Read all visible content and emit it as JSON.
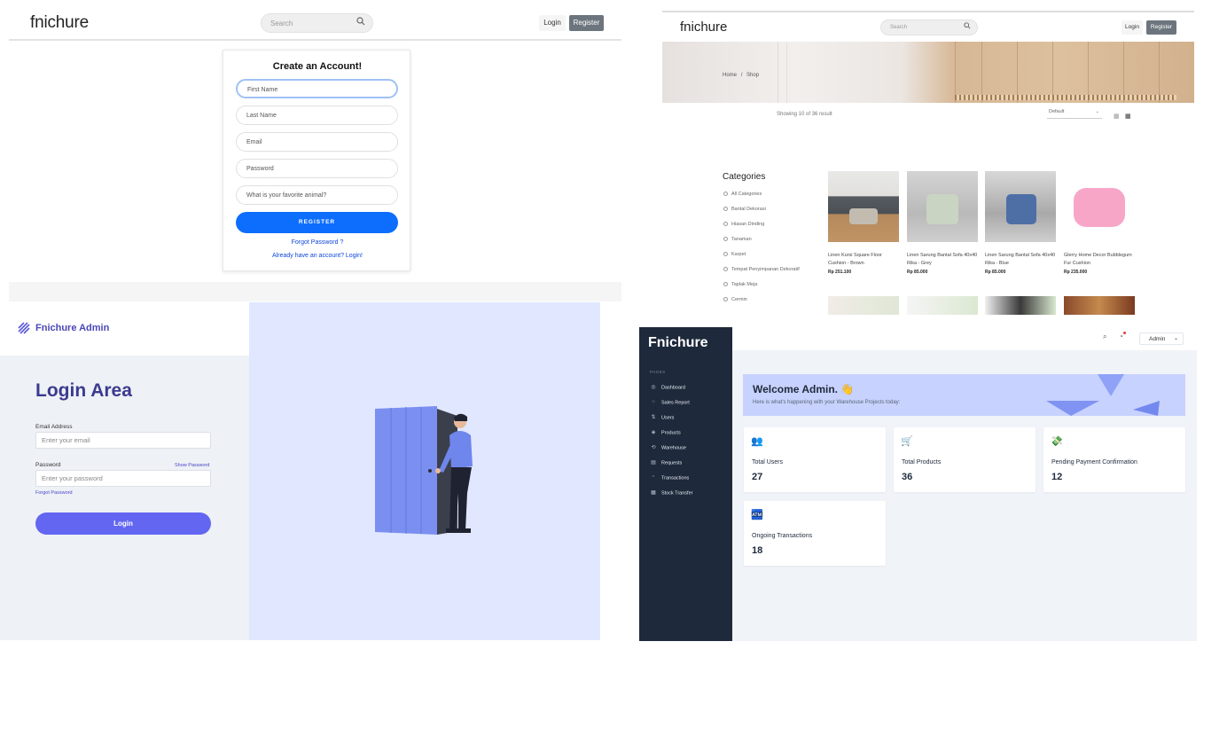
{
  "register_page": {
    "brand": "fnichure",
    "search_placeholder": "Search",
    "login_label": "Login",
    "register_label": "Register",
    "form": {
      "title": "Create an Account!",
      "first_name_placeholder": "First Name",
      "last_name_placeholder": "Last Name",
      "email_placeholder": "Email",
      "password_placeholder": "Password",
      "security_question_placeholder": "What is your favorite animal?",
      "submit_label": "REGISTER",
      "forgot_link": "Forgot Password ?",
      "login_link": "Already have an account? Login!"
    }
  },
  "shop_page": {
    "brand": "fnichure",
    "search_placeholder": "Search",
    "login_label": "Login",
    "register_label": "Register",
    "breadcrumb_home": "Home",
    "breadcrumb_sep": "/",
    "breadcrumb_current": "Shop",
    "showing_text": "Showing 10 of 36 result",
    "sort_value": "Default",
    "categories_title": "Categories",
    "categories": [
      "All Categories",
      "Bantal Dekorasi",
      "Hiasan Dinding",
      "Tanaman",
      "Karpet",
      "Tempat Penyimpanan Dekoratif",
      "Taplak Meja",
      "Cermin"
    ],
    "products": [
      {
        "name": "Linen Kursi Square Floor Cushion - Brown",
        "price": "Rp 251.100"
      },
      {
        "name": "Linen Sarung Bantal Sofa 40x40 Rika - Grey",
        "price": "Rp 85.000"
      },
      {
        "name": "Linen Sarung Bantal Sofa 40x40 Rika - Blue",
        "price": "Rp 85.000"
      },
      {
        "name": "Glerry Home Decor Bubblegum Fur Cushion",
        "price": "Rp 235.000"
      }
    ]
  },
  "admin_login_page": {
    "brand": "Fnichure Admin",
    "title": "Login Area",
    "email_label": "Email Address",
    "email_placeholder": "Enter your email",
    "password_label": "Password",
    "show_password": "Show Password",
    "password_placeholder": "Enter your password",
    "forgot_link": "Forgot Password",
    "login_label": "Login"
  },
  "dashboard_page": {
    "brand": "Fnichure",
    "section_label": "PAGES",
    "sidebar_items": [
      {
        "label": "Dashboard",
        "icon": "dashboard-icon"
      },
      {
        "label": "Sales Report",
        "icon": "chart-icon"
      },
      {
        "label": "Users",
        "icon": "users-icon"
      },
      {
        "label": "Products",
        "icon": "box-icon"
      },
      {
        "label": "Warehouse",
        "icon": "warehouse-icon"
      },
      {
        "label": "Requests",
        "icon": "clipboard-icon"
      },
      {
        "label": "Transactions",
        "icon": "transactions-icon"
      },
      {
        "label": "Stock Transfer",
        "icon": "transfer-icon"
      }
    ],
    "admin_label": "Admin",
    "welcome_title": "Welcome Admin. 👋",
    "welcome_subtitle": "Here is what's happening with your Warehouse Projects today:",
    "stats": [
      {
        "label": "Total Users",
        "value": "27",
        "icon": "users-icon"
      },
      {
        "label": "Total Products",
        "value": "36",
        "icon": "cart-icon"
      },
      {
        "label": "Pending Payment Confirmation",
        "value": "12",
        "icon": "money-icon"
      },
      {
        "label": "Ongoing Transactions",
        "value": "18",
        "icon": "register-icon"
      }
    ],
    "colors": {
      "sidebar": "#1e293b",
      "banner": "#c7d2fe",
      "accent": "#6366f1"
    }
  }
}
